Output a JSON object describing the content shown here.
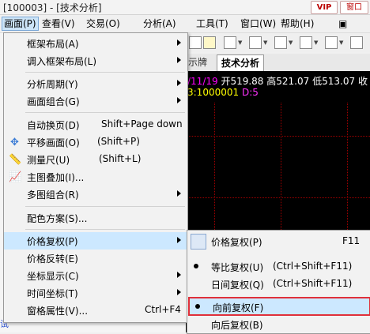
{
  "window": {
    "title": "[100003] - [技术分析]",
    "vip_label": "VIP",
    "window_label": "窗口"
  },
  "menubar": [
    {
      "label": "画面(P)"
    },
    {
      "label": "查看(V)"
    },
    {
      "label": "交易(O)"
    },
    {
      "label": "分析(A)"
    },
    {
      "label": "工具(T)"
    },
    {
      "label": "窗口(W)"
    },
    {
      "label": "帮助(H)"
    }
  ],
  "tabs": {
    "previous": "示牌",
    "active": "技术分析"
  },
  "chart_info": {
    "date": "/11/19",
    "open": "开519.88",
    "high": "高521.07",
    "low": "低513.07",
    "close_prefix": "收",
    "sub_line": "3:1000001",
    "d_label": "D:5"
  },
  "side_labels": [
    "试"
  ],
  "dropdown": {
    "items": [
      {
        "label": "框架布局(A)",
        "shortcut": "",
        "submenu": true
      },
      {
        "label": "调入框架布局(L)",
        "shortcut": "",
        "submenu": true
      },
      {
        "label": "分析周期(Y)",
        "shortcut": "",
        "submenu": true
      },
      {
        "label": "画面组合(G)",
        "shortcut": "",
        "submenu": true
      },
      {
        "label": "自动换页(D)",
        "shortcut": "Shift+Page down",
        "submenu": false
      },
      {
        "label": "平移画面(O)",
        "shortcut": "(Shift+P)",
        "submenu": false,
        "icon": "move-arrows-icon"
      },
      {
        "label": "测量尺(U)",
        "shortcut": "(Shift+L)",
        "submenu": false,
        "icon": "ruler-icon"
      },
      {
        "label": "主图叠加(I)...",
        "shortcut": "",
        "submenu": false,
        "icon": "chart-overlay-icon"
      },
      {
        "label": "多图组合(R)",
        "shortcut": "",
        "submenu": true
      },
      {
        "label": "配色方案(S)...",
        "shortcut": "",
        "submenu": false
      },
      {
        "label": "价格复权(P)",
        "shortcut": "",
        "submenu": true
      },
      {
        "label": "价格反转(E)",
        "shortcut": "",
        "submenu": false
      },
      {
        "label": "坐标显示(C)",
        "shortcut": "",
        "submenu": true
      },
      {
        "label": "时间坐标(T)",
        "shortcut": "",
        "submenu": true
      },
      {
        "label": "窗格属性(V)...",
        "shortcut": "Ctrl+F4",
        "submenu": false
      }
    ]
  },
  "submenu": {
    "items": [
      {
        "label": "价格复权(P)",
        "shortcut": "F11",
        "state": "icon"
      },
      {
        "label": "等比复权(U)",
        "shortcut": "(Ctrl+Shift+F11)",
        "state": "checked"
      },
      {
        "label": "日间复权(Q)",
        "shortcut": "(Ctrl+Shift+F11)",
        "state": "none"
      },
      {
        "label": "向前复权(F)",
        "shortcut": "",
        "state": "checked"
      },
      {
        "label": "向后复权(B)",
        "shortcut": "",
        "state": "none"
      }
    ]
  },
  "colors": {
    "menu_highlight": "#cce8ff",
    "annotation_box": "#e0303a",
    "chart_bg": "#000000"
  }
}
